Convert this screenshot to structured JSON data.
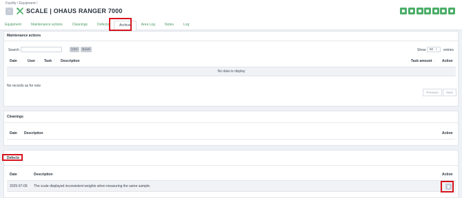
{
  "header": {
    "breadcrumb": "Facility / Equipment /",
    "back_icon": "arrow-left-icon",
    "title_icon": "tools-icon",
    "title": "SCALE | OHAUS RANGER 7000",
    "action_icons": [
      "copy-icon",
      "edit-icon",
      "download-icon",
      "qr-icon",
      "print-icon",
      "export-icon",
      "pencil-icon"
    ],
    "accent_color": "#4cae6a"
  },
  "tabs": [
    {
      "label": "Equipment"
    },
    {
      "label": "Maintenance actions"
    },
    {
      "label": "Cleanings"
    },
    {
      "label": "Defects"
    },
    {
      "label": "Archive"
    },
    {
      "label": "Area Log"
    },
    {
      "label": "Notes"
    },
    {
      "label": "Log"
    }
  ],
  "maintenance": {
    "title": "Maintenance actions",
    "search_label": "Search",
    "search_value": "",
    "csv_label": "CSV",
    "excel_label": "Excel",
    "show_label": "Show",
    "page_size": "50",
    "entries_label": "entries",
    "columns": [
      "Date",
      "User",
      "Task",
      "Description",
      "Task amount",
      "Action"
    ],
    "empty_text": "No data to display",
    "no_records": "No records as for now",
    "previous_label": "Previous",
    "next_label": "Next"
  },
  "cleanings": {
    "title": "Cleanings",
    "columns": [
      "Date",
      "Description",
      "Action"
    ]
  },
  "defects": {
    "title": "Defects",
    "columns": [
      "Date",
      "Description",
      "Action"
    ],
    "rows": [
      {
        "date": "2025-07-09",
        "description": "The scale displayed inconsistent weights when measuring the same sample.",
        "action_icon": "trash-icon"
      }
    ]
  }
}
